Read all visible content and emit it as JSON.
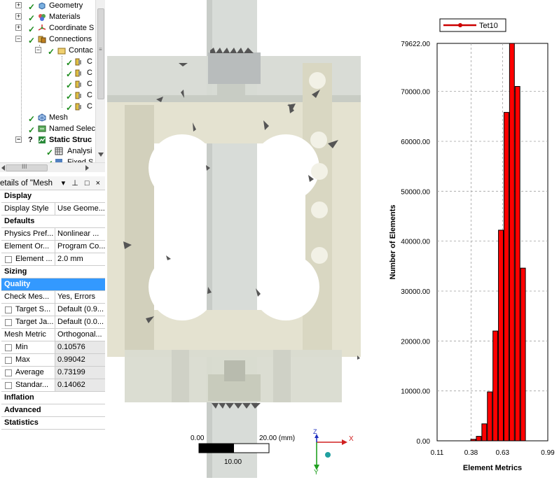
{
  "tree": {
    "items": [
      {
        "label": "Geometry"
      },
      {
        "label": "Materials"
      },
      {
        "label": "Coordinate S"
      },
      {
        "label": "Connections"
      },
      {
        "label": "Contac"
      },
      {
        "label": "C"
      },
      {
        "label": "C"
      },
      {
        "label": "C"
      },
      {
        "label": "C"
      },
      {
        "label": "C"
      },
      {
        "label": "Mesh"
      },
      {
        "label": "Named Selec"
      },
      {
        "label": "Static Struc"
      },
      {
        "label": "Analysi"
      },
      {
        "label": "Fixed S"
      }
    ],
    "hscroll_grip": "III"
  },
  "details": {
    "title": "etails of \"Mesh",
    "controls": "▾ ⊥ □ ×",
    "rows": [
      {
        "type": "section",
        "label": "Display"
      },
      {
        "type": "prop",
        "key": "Display Style",
        "value": "Use Geome..."
      },
      {
        "type": "section",
        "label": "Defaults"
      },
      {
        "type": "prop",
        "key": "Physics Pref...",
        "value": "Nonlinear ..."
      },
      {
        "type": "prop",
        "key": "Element Or...",
        "value": "Program Co..."
      },
      {
        "type": "check",
        "key": "Element ...",
        "value": "2.0 mm"
      },
      {
        "type": "section",
        "label": "Sizing"
      },
      {
        "type": "selected",
        "label": "Quality"
      },
      {
        "type": "prop",
        "key": "Check Mes...",
        "value": "Yes, Errors"
      },
      {
        "type": "check",
        "key": "Target S...",
        "value": "Default (0.9..."
      },
      {
        "type": "check",
        "key": "Target Ja...",
        "value": "Default (0.0..."
      },
      {
        "type": "prop",
        "key": "Mesh Metric",
        "value": "Orthogonal..."
      },
      {
        "type": "checkgrey",
        "key": "Min",
        "value": "0.10576"
      },
      {
        "type": "checkgrey",
        "key": "Max",
        "value": "0.99042"
      },
      {
        "type": "checkgrey",
        "key": "Average",
        "value": "0.73199"
      },
      {
        "type": "checkgrey",
        "key": "Standar...",
        "value": "0.14062"
      },
      {
        "type": "section",
        "label": "Inflation"
      },
      {
        "type": "section",
        "label": "Advanced"
      },
      {
        "type": "section",
        "label": "Statistics"
      }
    ]
  },
  "viewport": {
    "scale_start": "0.00",
    "scale_end": "20.00 (mm)",
    "scale_mid": "10.00",
    "triad_x": "X",
    "triad_y": "Y",
    "triad_z": "Z"
  },
  "chart_data": {
    "type": "bar",
    "legend": "Tet10",
    "xlabel": "Element Metrics",
    "ylabel": "Number of Elements",
    "x_ticks": [
      "0.11",
      "0.38",
      "0.63",
      "0.99"
    ],
    "x_tick_values": [
      0.11,
      0.38,
      0.63,
      0.99
    ],
    "xlim": [
      0.11,
      0.99
    ],
    "y_ticks": [
      "0.00",
      "10000.00",
      "20000.00",
      "30000.00",
      "40000.00",
      "50000.00",
      "60000.00",
      "70000.00",
      "79622.00"
    ],
    "y_tick_values": [
      0,
      10000,
      20000,
      30000,
      40000,
      50000,
      60000,
      70000,
      79622
    ],
    "ylim": [
      0,
      79622
    ],
    "bin_width": 0.044,
    "bins": [
      0.133,
      0.177,
      0.221,
      0.265,
      0.309,
      0.353,
      0.397,
      0.441,
      0.485,
      0.529,
      0.573,
      0.617,
      0.661,
      0.705,
      0.749,
      0.793,
      0.837,
      0.881,
      0.925,
      0.969
    ],
    "values": [
      0,
      0,
      0,
      0,
      0,
      0,
      300,
      900,
      3400,
      9800,
      22000,
      42200,
      65800,
      79622,
      71000,
      34600,
      0,
      0,
      0,
      0
    ],
    "colors": {
      "bar": "#ff0000",
      "legend_line": "#cc0000",
      "grid": "#a0a0a0"
    }
  }
}
